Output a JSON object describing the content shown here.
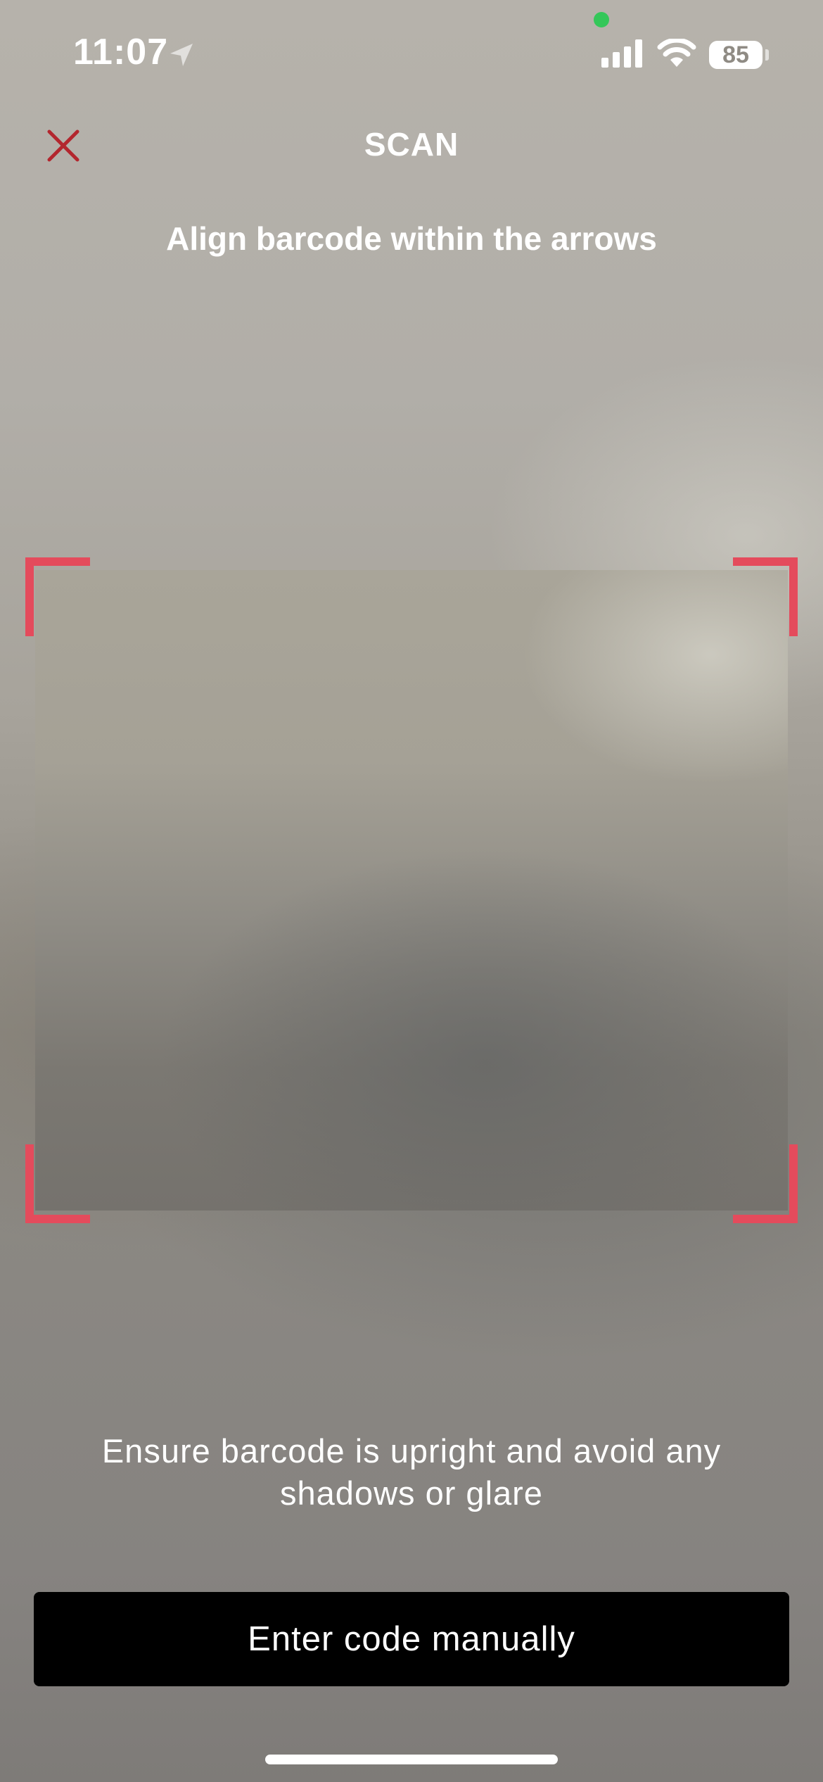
{
  "status_bar": {
    "time": "11:07",
    "battery_level": "85",
    "icons": [
      "location-arrow-icon",
      "cellular-signal-icon",
      "wifi-icon",
      "battery-icon"
    ],
    "privacy_indicator_color": "#34c759"
  },
  "header": {
    "title": "SCAN",
    "close_icon": "close-icon",
    "close_color": "#b3262e"
  },
  "scanner": {
    "instruction": "Align barcode within the arrows",
    "frame_color": "#e44b5c",
    "tip": "Ensure barcode is upright and avoid any shadows or glare"
  },
  "actions": {
    "manual_entry_label": "Enter code manually"
  }
}
